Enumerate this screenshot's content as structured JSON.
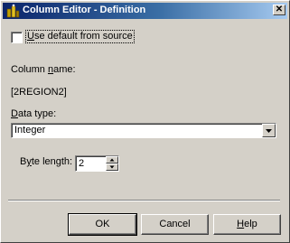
{
  "window": {
    "title": "Column Editor - Definition",
    "close_glyph": "✕"
  },
  "use_default": {
    "label": "Use default from source",
    "checked": false
  },
  "column_name": {
    "label": "Column name:",
    "value": "[2REGION2]"
  },
  "data_type": {
    "label": "Data type:",
    "selected": "Integer"
  },
  "byte_length": {
    "label": "Byte length:",
    "value": "2"
  },
  "buttons": {
    "ok": "OK",
    "cancel": "Cancel",
    "help": "Help"
  },
  "icons": {
    "title": "column-editor-app-icon",
    "dropdown": "chevron-down-icon",
    "spin_up": "spin-up-arrow-icon",
    "spin_down": "spin-down-arrow-icon",
    "close": "close-icon"
  },
  "colors": {
    "titlebar_start": "#0a246a",
    "titlebar_end": "#a6caf0",
    "dialog_face": "#d4d0c8"
  }
}
